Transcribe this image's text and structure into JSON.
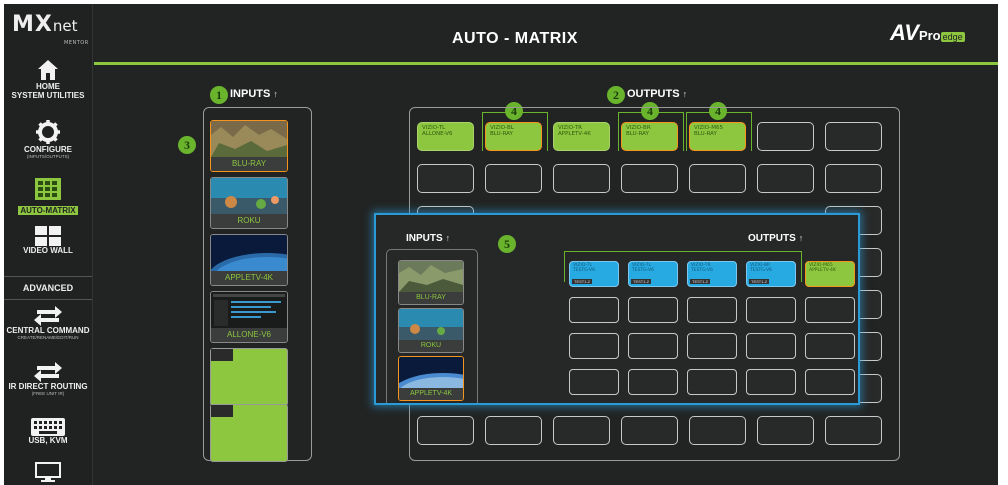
{
  "app": {
    "logo_main": "MX",
    "logo_net": "net",
    "logo_sub": "MENTOR",
    "title": "AUTO - MATRIX",
    "brand": {
      "av": "AV",
      "pro": "Pro",
      "edge": "edge"
    }
  },
  "sidebar": {
    "items": [
      {
        "label": "HOME",
        "label2": "SYSTEM UTILITIES",
        "icon": "home-icon"
      },
      {
        "label": "CONFIGURE",
        "sub": "(INPUTS/OUTPUTS)",
        "icon": "gear-icon"
      },
      {
        "label": "AUTO-MATRIX",
        "icon": "matrix-grid-icon",
        "active": true
      },
      {
        "label": "VIDEO WALL",
        "icon": "video-wall-icon"
      },
      {
        "label": "CENTRAL COMMAND",
        "sub": "CREATE/RENAME/EDIT/RUN",
        "icon": "swap-arrows-icon"
      },
      {
        "label": "IR DIRECT ROUTING",
        "sub": "(FREE UNIT IR)",
        "icon": "swap-arrows-icon"
      },
      {
        "label": "USB, KVM",
        "icon": "keyboard-icon"
      },
      {
        "label": "",
        "icon": "monitor-icon"
      }
    ],
    "advanced": "ADVANCED"
  },
  "inputs": {
    "header": "INPUTS",
    "sources": [
      {
        "name": "BLU-RAY",
        "selected": true
      },
      {
        "name": "ROKU"
      },
      {
        "name": "APPLETV-4K"
      },
      {
        "name": "ALLONE-V6"
      }
    ]
  },
  "outputs": {
    "header": "OUTPUTS",
    "row1": [
      {
        "line1": "VIZIO-TL",
        "line2": "ALLONE-V6"
      },
      {
        "line1": "VIZIO-BL",
        "line2": "BLU-RAY",
        "orange": true
      },
      {
        "line1": "VIZIO-TR",
        "line2": "APPLETV-4K"
      },
      {
        "line1": "VIZIO-BR",
        "line2": "BLU-RAY",
        "orange": true
      },
      {
        "line1": "VIZIO-M65",
        "line2": "BLU-RAY",
        "orange": true
      }
    ]
  },
  "badges": [
    "1",
    "2",
    "3",
    "4",
    "4",
    "4",
    "5"
  ],
  "popup": {
    "inputs_header": "INPUTS",
    "outputs_header": "OUTPUTS",
    "sources": [
      {
        "name": "BLU-RAY"
      },
      {
        "name": "ROKU"
      },
      {
        "name": "APPLETV-4K",
        "selected": true
      }
    ],
    "row1": [
      {
        "line1": "VIZIO-TL",
        "line2": "TESTG-V6",
        "sub": "TEST1-2"
      },
      {
        "line1": "VIZIO-TL",
        "line2": "TESTG-V6",
        "sub": "TEST1-2"
      },
      {
        "line1": "VIZIO-TR",
        "line2": "TESTG-V6",
        "sub": "TEST1-2"
      },
      {
        "line1": "VIZIO-BR",
        "line2": "TESTG-V6",
        "sub": "TEST1-2"
      },
      {
        "line1": "VIZIO-M65",
        "line2": "APPLETV-4K"
      }
    ]
  }
}
